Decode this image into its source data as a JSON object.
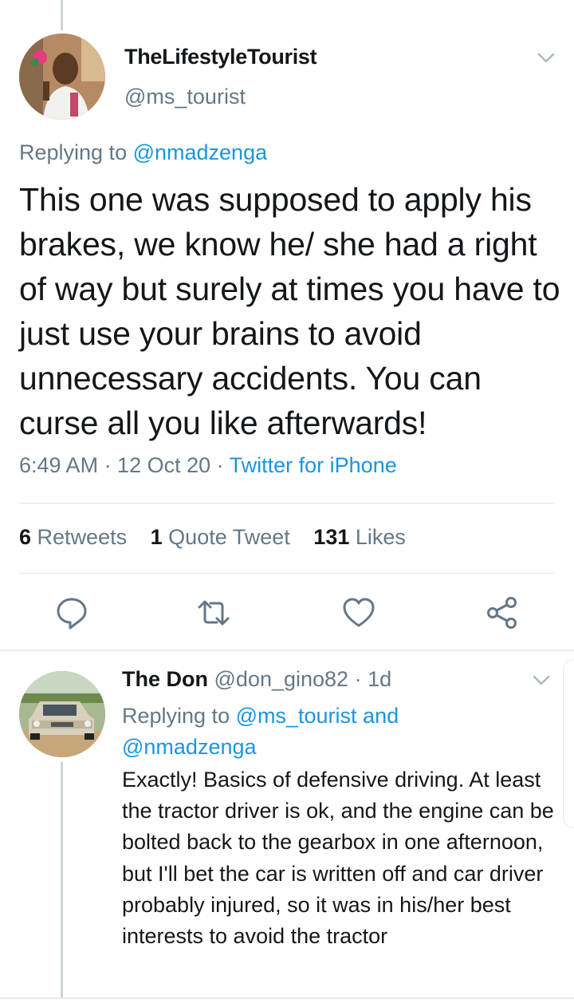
{
  "main_tweet": {
    "display_name": "TheLifestyleTourist",
    "handle": "@ms_tourist",
    "replying_prefix": "Replying to ",
    "replying_to": "@nmadzenga",
    "text": "This one was supposed to apply his brakes, we know he/ she had a right of way but surely at times you have to just use your brains to avoid unnecessary accidents. You can curse all you like afterwards!",
    "time": "6:49 AM · 12 Oct 20 · ",
    "source": "Twitter for iPhone"
  },
  "stats": {
    "retweets_count": "6",
    "retweets_label": "Retweets",
    "quotes_count": "1",
    "quotes_label": "Quote Tweet",
    "likes_count": "131",
    "likes_label": "Likes"
  },
  "actions": [
    {
      "name": "reply-icon"
    },
    {
      "name": "retweet-icon"
    },
    {
      "name": "like-icon"
    },
    {
      "name": "share-icon"
    }
  ],
  "reply_tweet": {
    "display_name": "The Don",
    "handle": "@don_gino82",
    "time": " · 1d",
    "replying_prefix": "Replying to ",
    "replying_to_1": "@ms_tourist",
    "replying_and": " and ",
    "replying_to_2": "@nmadzenga",
    "text": "Exactly! Basics of defensive driving. At least the tractor driver is ok, and the engine can be bolted back to the gearbox in one afternoon, but I'll bet the car is written off and car driver probably injured, so it was in his/her best interests to avoid the tractor"
  },
  "colors": {
    "link": "#1b95e0",
    "secondary_text": "#657786",
    "primary_text": "#14171a",
    "icon": "#657786"
  }
}
